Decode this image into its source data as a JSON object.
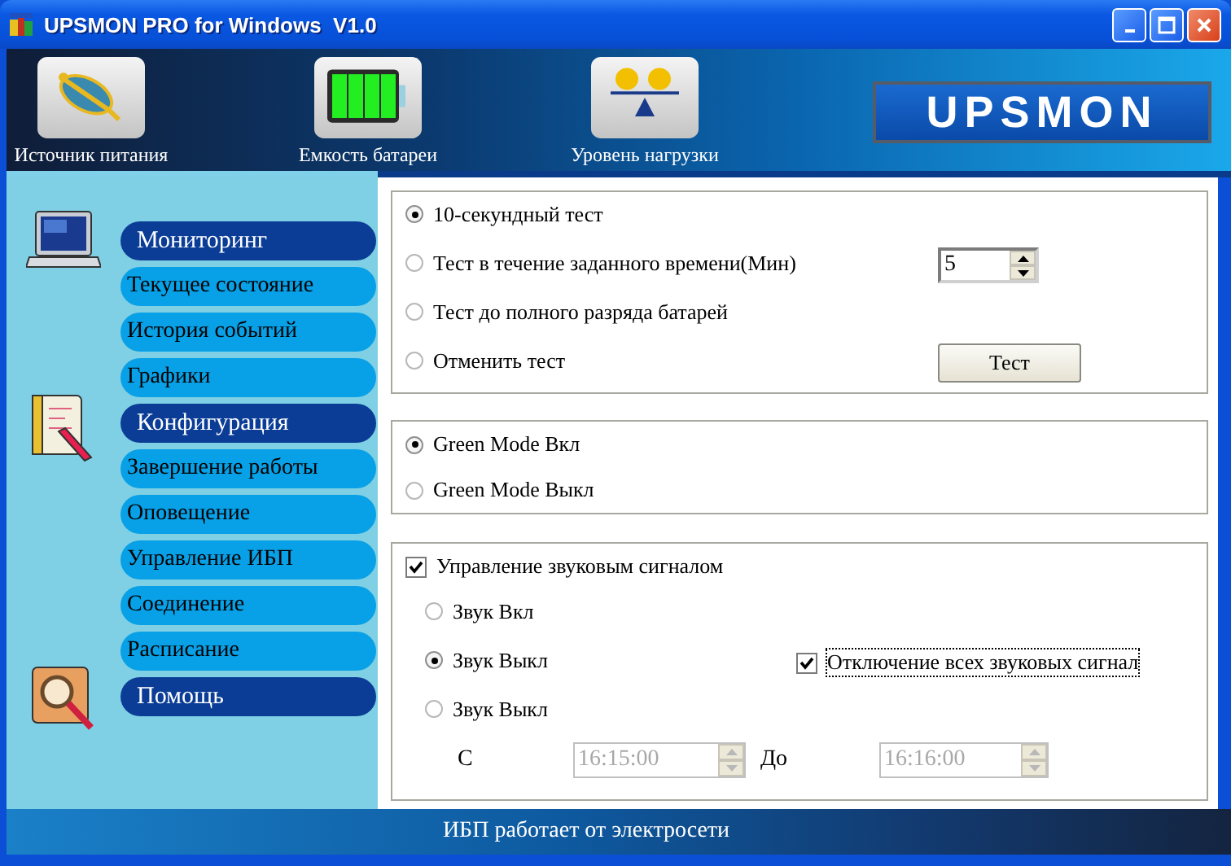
{
  "window": {
    "title": "UPSMON PRO for Windows  V1.0"
  },
  "toolbar": {
    "buttons": [
      {
        "label": "Источник питания"
      },
      {
        "label": "Емкость батареи"
      },
      {
        "label": "Уровень нагрузки"
      }
    ],
    "logo": "UPSMON"
  },
  "sidebar": {
    "groups": [
      {
        "label": "Мониторинг",
        "children": [
          {
            "label": "Текущее состояние"
          },
          {
            "label": "История событий"
          },
          {
            "label": "Графики"
          }
        ]
      },
      {
        "label": "Конфигурация",
        "children": [
          {
            "label": "Завершение работы"
          },
          {
            "label": "Оповещение"
          },
          {
            "label": "Управление ИБП"
          },
          {
            "label": "Соединение"
          },
          {
            "label": "Расписание"
          }
        ]
      },
      {
        "label": "Помощь"
      }
    ]
  },
  "self_test": {
    "options": [
      {
        "label": "10-секундный тест",
        "selected": true
      },
      {
        "label": "Тест в течение заданного времени(Мин)",
        "selected": false
      },
      {
        "label": "Тест до полного разряда батарей",
        "selected": false
      },
      {
        "label": "Отменить тест",
        "selected": false
      }
    ],
    "duration": "5",
    "button": "Тест"
  },
  "green_mode": {
    "options": [
      {
        "label": "Green Mode Вкл",
        "selected": true
      },
      {
        "label": "Green Mode Выкл",
        "selected": false
      }
    ]
  },
  "sound": {
    "control": {
      "label": "Управление звуковым сигналом",
      "checked": true
    },
    "options": [
      {
        "label": "Звук Вкл",
        "selected": false
      },
      {
        "label": "Звук Выкл",
        "selected": true
      },
      {
        "label": "Звук Выкл",
        "selected": false
      }
    ],
    "mute_all": {
      "label": "Отключение всех звуковых сигнал",
      "checked": true
    },
    "schedule": {
      "from_label": "С",
      "from": "16:15:00",
      "to_label": "До",
      "to": "16:16:00",
      "disabled": true
    }
  },
  "status_bar": "ИБП работает от электросети"
}
